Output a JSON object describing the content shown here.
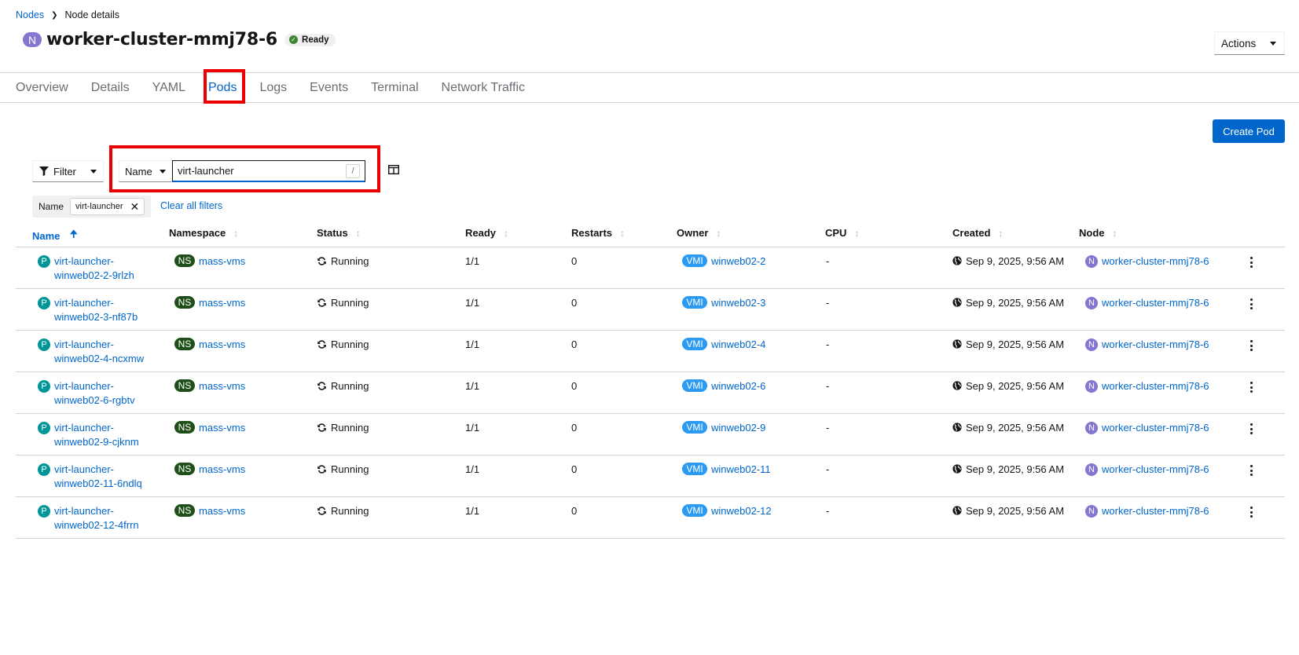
{
  "breadcrumb": {
    "parent": "Nodes",
    "current": "Node details"
  },
  "header": {
    "badge": "N",
    "title": "worker-cluster-mmj78-6",
    "status": "Ready",
    "actions_label": "Actions"
  },
  "tabs": [
    {
      "label": "Overview"
    },
    {
      "label": "Details"
    },
    {
      "label": "YAML"
    },
    {
      "label": "Pods",
      "active": true
    },
    {
      "label": "Logs"
    },
    {
      "label": "Events"
    },
    {
      "label": "Terminal"
    },
    {
      "label": "Network Traffic"
    }
  ],
  "toolbar": {
    "create_label": "Create Pod",
    "filter_label": "Filter",
    "filter_attribute": "Name",
    "search_value": "virt-launcher",
    "search_shortcut": "/",
    "chip_category": "Name",
    "chip_value": "virt-launcher",
    "clear_all_label": "Clear all filters"
  },
  "table": {
    "columns": [
      "Name",
      "Namespace",
      "Status",
      "Ready",
      "Restarts",
      "Owner",
      "CPU",
      "Created",
      "Node"
    ],
    "sorted_column": "Name",
    "rows": [
      {
        "name_line1": "virt-launcher-",
        "name_line2": "winweb02-2-9rlzh",
        "namespace": "mass-vms",
        "status": "Running",
        "ready": "1/1",
        "restarts": "0",
        "owner": "winweb02-2",
        "cpu": "-",
        "created": "Sep 9, 2025, 9:56 AM",
        "node": "worker-cluster-mmj78-6"
      },
      {
        "name_line1": "virt-launcher-",
        "name_line2": "winweb02-3-nf87b",
        "namespace": "mass-vms",
        "status": "Running",
        "ready": "1/1",
        "restarts": "0",
        "owner": "winweb02-3",
        "cpu": "-",
        "created": "Sep 9, 2025, 9:56 AM",
        "node": "worker-cluster-mmj78-6"
      },
      {
        "name_line1": "virt-launcher-",
        "name_line2": "winweb02-4-ncxmw",
        "namespace": "mass-vms",
        "status": "Running",
        "ready": "1/1",
        "restarts": "0",
        "owner": "winweb02-4",
        "cpu": "-",
        "created": "Sep 9, 2025, 9:56 AM",
        "node": "worker-cluster-mmj78-6"
      },
      {
        "name_line1": "virt-launcher-",
        "name_line2": "winweb02-6-rgbtv",
        "namespace": "mass-vms",
        "status": "Running",
        "ready": "1/1",
        "restarts": "0",
        "owner": "winweb02-6",
        "cpu": "-",
        "created": "Sep 9, 2025, 9:56 AM",
        "node": "worker-cluster-mmj78-6"
      },
      {
        "name_line1": "virt-launcher-",
        "name_line2": "winweb02-9-cjknm",
        "namespace": "mass-vms",
        "status": "Running",
        "ready": "1/1",
        "restarts": "0",
        "owner": "winweb02-9",
        "cpu": "-",
        "created": "Sep 9, 2025, 9:56 AM",
        "node": "worker-cluster-mmj78-6"
      },
      {
        "name_line1": "virt-launcher-",
        "name_line2": "winweb02-11-6ndlq",
        "namespace": "mass-vms",
        "status": "Running",
        "ready": "1/1",
        "restarts": "0",
        "owner": "winweb02-11",
        "cpu": "-",
        "created": "Sep 9, 2025, 9:56 AM",
        "node": "worker-cluster-mmj78-6"
      },
      {
        "name_line1": "virt-launcher-",
        "name_line2": "winweb02-12-4frrn",
        "namespace": "mass-vms",
        "status": "Running",
        "ready": "1/1",
        "restarts": "0",
        "owner": "winweb02-12",
        "cpu": "-",
        "created": "Sep 9, 2025, 9:56 AM",
        "node": "worker-cluster-mmj78-6"
      }
    ]
  },
  "badges": {
    "pod": "P",
    "namespace": "NS",
    "owner": "VMI",
    "node": "N"
  },
  "icons": {
    "breadcrumb_sep": "chevron-right-icon",
    "status_check": "check-circle-icon",
    "filter": "filter-icon",
    "columns": "columns-icon",
    "status": "sync-icon",
    "created": "globe-icon",
    "row_actions": "kebab-icon",
    "sort_asc": "arrow-up-icon",
    "sort": "sort-icon",
    "chip_remove": "close-icon"
  },
  "colors": {
    "accent": "#0066cc",
    "node_badge": "#8476d1",
    "pod_badge": "#009596",
    "namespace_badge": "#1e4f18",
    "vmi_badge": "#2b9af3",
    "ready_check": "#3e8635",
    "highlight": "#ee0000"
  }
}
